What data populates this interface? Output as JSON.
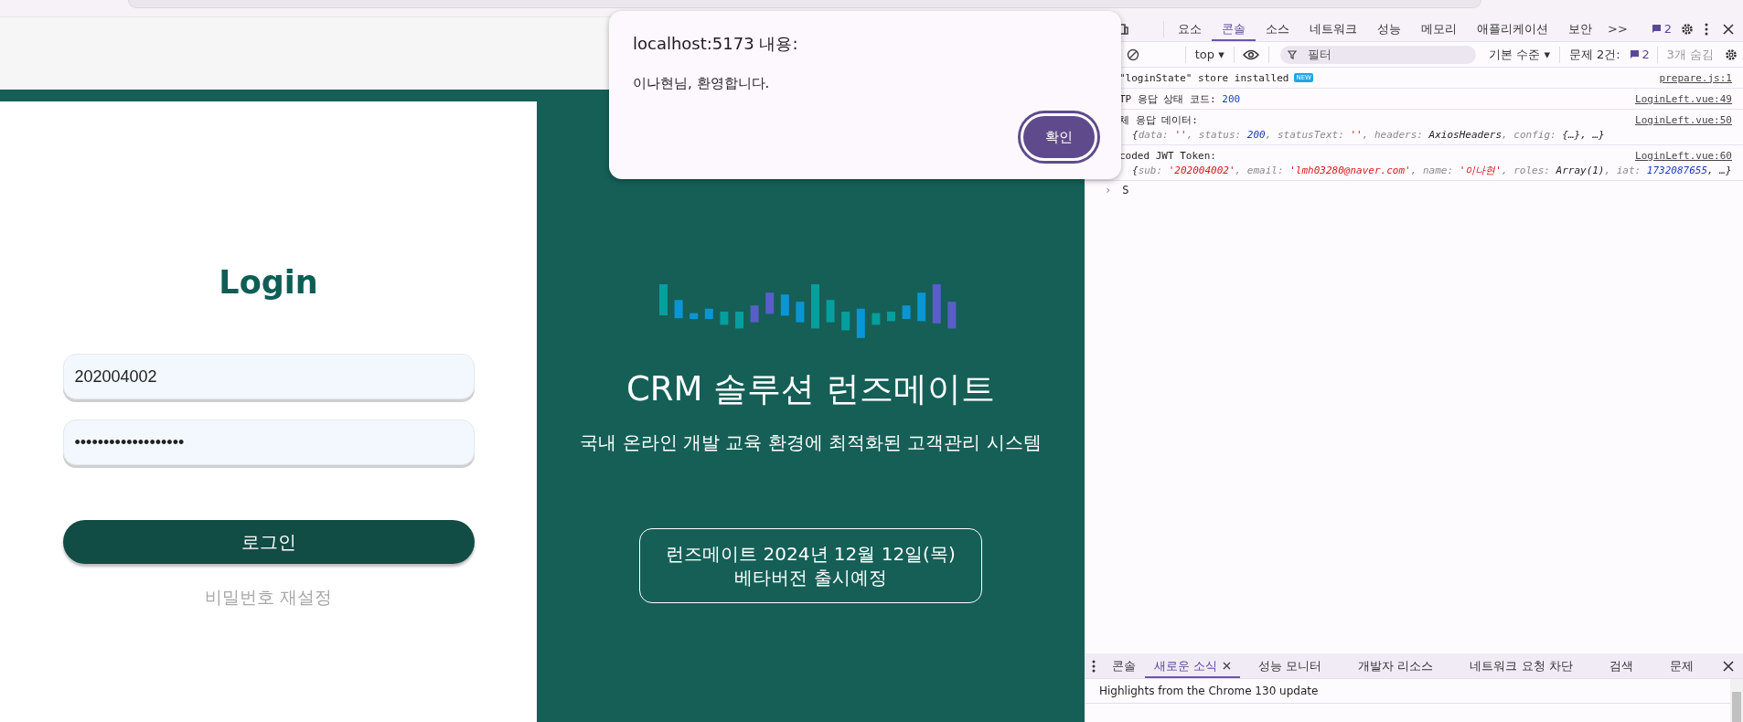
{
  "login": {
    "title": "Login",
    "id_value": "202004002",
    "password_value": "•••••••••••••••••••",
    "submit": "로그인",
    "reset_link": "비밀번호 재설정"
  },
  "promo": {
    "title": "CRM 솔루션 런즈메이트",
    "subtitle": "국내 온라인 개발 교육 환경에 최적화된 고객관리 시스템",
    "notice": [
      "런즈메이트 2024년 12월 12일(목)",
      "베타버전 출시예정"
    ]
  },
  "dialog": {
    "title": "localhost:5173 내용:",
    "message": "이나현님, 환영합니다.",
    "button": "확인"
  },
  "devtools": {
    "tabs": [
      {
        "label": "요소",
        "selected": false
      },
      {
        "label": "콘솔",
        "selected": true
      },
      {
        "label": "소스",
        "selected": false
      },
      {
        "label": "네트워크",
        "selected": false
      },
      {
        "label": "성능",
        "selected": false
      },
      {
        "label": "메모리",
        "selected": false
      },
      {
        "label": "애플리케이션",
        "selected": false
      },
      {
        "label": "보안",
        "selected": false
      }
    ],
    "more_tabs": ">>",
    "issues_count": "2",
    "toolbar": {
      "context": "top ▾",
      "filter_placeholder": "필터",
      "level": "기본 수준 ▾",
      "issues_label": "문제 2건:",
      "issues_count": "2",
      "hidden": "3개 숨김"
    },
    "messages": [
      {
        "segments": [
          {
            "text": "\"loginState\" store installed",
            "kind": "plain"
          }
        ],
        "badge": "NEW",
        "source": "prepare.js:1"
      },
      {
        "segments": [
          {
            "text": "TP 응답 상태 코드: ",
            "kind": "plain"
          },
          {
            "text": "200",
            "kind": "number"
          }
        ],
        "source": "LoginLeft.vue:49"
      },
      {
        "segments": [
          {
            "text": "체 응답 데이터:",
            "kind": "plain"
          }
        ],
        "source": "LoginLeft.vue:50",
        "object": [
          {
            "text": "{",
            "kind": "plain"
          },
          {
            "text": "data: ",
            "kind": "key"
          },
          {
            "text": "''",
            "kind": "string"
          },
          {
            "text": ", status: ",
            "kind": "key"
          },
          {
            "text": "200",
            "kind": "number"
          },
          {
            "text": ", statusText: ",
            "kind": "key"
          },
          {
            "text": "''",
            "kind": "string"
          },
          {
            "text": ", headers: ",
            "kind": "key"
          },
          {
            "text": "AxiosHeaders",
            "kind": "plain"
          },
          {
            "text": ", config: ",
            "kind": "key"
          },
          {
            "text": "{…}, …}",
            "kind": "plain"
          }
        ]
      },
      {
        "segments": [
          {
            "text": "coded JWT Token:",
            "kind": "plain"
          }
        ],
        "source": "LoginLeft.vue:60",
        "object": [
          {
            "text": "{",
            "kind": "plain"
          },
          {
            "text": "sub: ",
            "kind": "key"
          },
          {
            "text": "'202004002'",
            "kind": "string"
          },
          {
            "text": ", email: ",
            "kind": "key"
          },
          {
            "text": "'lmh03280@naver.com'",
            "kind": "string"
          },
          {
            "text": ", name: ",
            "kind": "key"
          },
          {
            "text": "'이나현'",
            "kind": "string"
          },
          {
            "text": ", roles: ",
            "kind": "key"
          },
          {
            "text": "Array(1)",
            "kind": "plain"
          },
          {
            "text": ", iat: ",
            "kind": "key"
          },
          {
            "text": "1732087655",
            "kind": "number"
          },
          {
            "text": ", …}",
            "kind": "plain"
          }
        ]
      }
    ],
    "prompt": {
      "symbol": "›",
      "input": "S"
    },
    "drawer": {
      "tabs": [
        {
          "label": "콘솔",
          "selected": false,
          "closable": false
        },
        {
          "label": "새로운 소식",
          "selected": true,
          "closable": true
        },
        {
          "label": "성능 모니터",
          "selected": false,
          "closable": false
        },
        {
          "label": "개발자 리소스",
          "selected": false,
          "closable": false
        },
        {
          "label": "네트워크 요청 차단",
          "selected": false,
          "closable": false
        },
        {
          "label": "검색",
          "selected": false,
          "closable": false
        },
        {
          "label": "문제",
          "selected": false,
          "closable": false
        }
      ],
      "content": "Highlights from the Chrome 130 update"
    }
  }
}
